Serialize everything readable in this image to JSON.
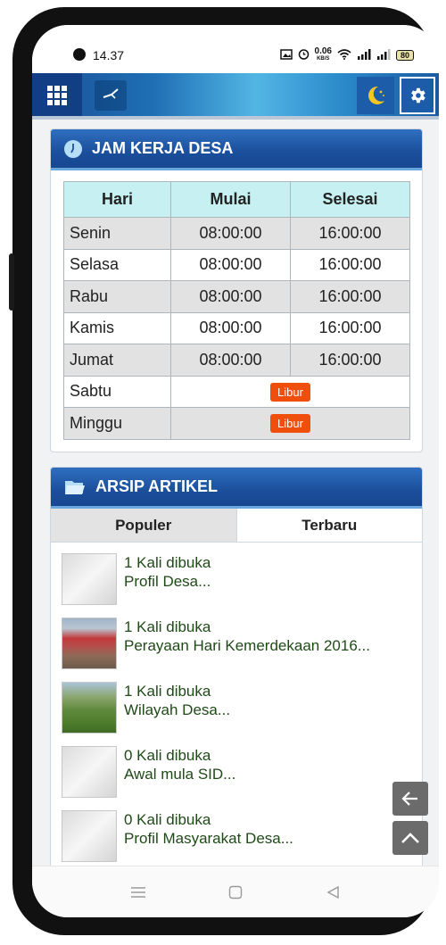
{
  "status_bar": {
    "time": "14.37",
    "data_speed": "0.06",
    "data_unit": "KB/S",
    "battery": "80"
  },
  "colors": {
    "header_blue": "#1b4f9c",
    "accent_orange": "#f04e0d",
    "table_header": "#c6f0f1",
    "article_text": "#1f4a17"
  },
  "schedule": {
    "title": "JAM KERJA DESA",
    "columns": [
      "Hari",
      "Mulai",
      "Selesai"
    ],
    "rows": [
      {
        "day": "Senin",
        "start": "08:00:00",
        "end": "16:00:00"
      },
      {
        "day": "Selasa",
        "start": "08:00:00",
        "end": "16:00:00"
      },
      {
        "day": "Rabu",
        "start": "08:00:00",
        "end": "16:00:00"
      },
      {
        "day": "Kamis",
        "start": "08:00:00",
        "end": "16:00:00"
      },
      {
        "day": "Jumat",
        "start": "08:00:00",
        "end": "16:00:00"
      },
      {
        "day": "Sabtu",
        "badge": "Libur"
      },
      {
        "day": "Minggu",
        "badge": "Libur"
      }
    ]
  },
  "archive": {
    "title": "ARSIP ARTIKEL",
    "tabs": [
      {
        "label": "Populer"
      },
      {
        "label": "Terbaru"
      }
    ],
    "articles": [
      {
        "views": "1 Kali dibuka",
        "title": "Profil Desa..."
      },
      {
        "views": "1 Kali dibuka",
        "title": "Perayaan Hari Kemerdekaan 2016..."
      },
      {
        "views": "1 Kali dibuka",
        "title": "Wilayah Desa..."
      },
      {
        "views": "0 Kali dibuka",
        "title": "Awal mula SID..."
      },
      {
        "views": "0 Kali dibuka",
        "title": "Profil Masyarakat Desa..."
      }
    ]
  },
  "icons": {
    "menu": "grid-icon",
    "clock": "clock-icon",
    "theme": "moon-icon",
    "settings": "gear-icon",
    "back": "arrow-left-icon",
    "top": "chevron-up-icon"
  }
}
